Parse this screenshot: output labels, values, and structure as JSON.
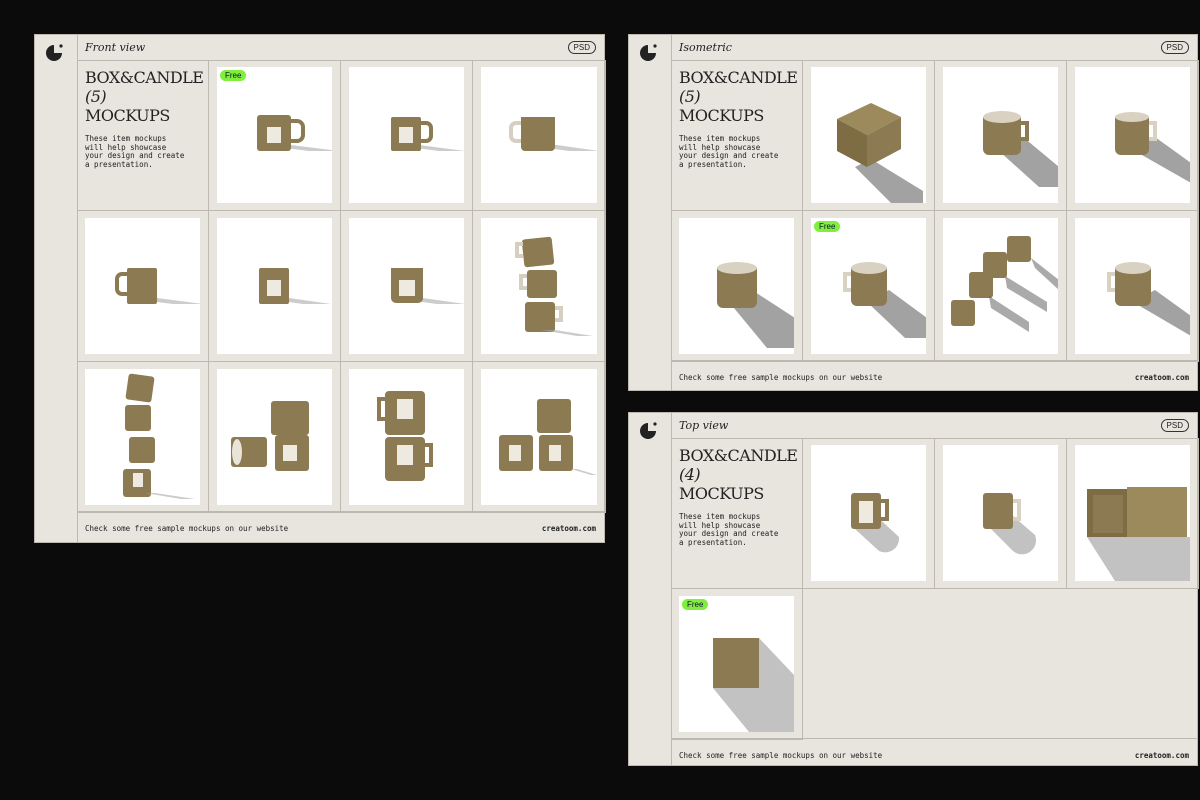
{
  "colors": {
    "background": "#0b0b0b",
    "panel": "#e8e5df",
    "line": "#bdb9b1",
    "mug": "#8b7a52",
    "free_badge": "#7ef03c"
  },
  "panels": [
    {
      "title": "Front view",
      "badge": "PSD",
      "intro": {
        "heading": "BOX&CANDLE",
        "count": "(5)",
        "subheading": "MOCKUPS",
        "text": "These item mockups will help showcase your design and create a presentation."
      },
      "footer": {
        "text": "Check some free sample mockups on our website",
        "link": "creatoom.com"
      },
      "free_label": "Free",
      "thumbnails": [
        {
          "icon": "mug-icon",
          "free": true
        },
        {
          "icon": "mug-icon"
        },
        {
          "icon": "mug-icon"
        },
        {
          "icon": "mug-icon"
        },
        {
          "icon": "mug-icon"
        },
        {
          "icon": "mug-icon"
        },
        {
          "icon": "mug-stack-icon"
        },
        {
          "icon": "mug-stack-icon"
        },
        {
          "icon": "mug-group-icon"
        },
        {
          "icon": "mug-stack-icon"
        },
        {
          "icon": "mug-group-icon"
        }
      ]
    },
    {
      "title": "Isometric",
      "badge": "PSD",
      "intro": {
        "heading": "BOX&CANDLE",
        "count": "(5)",
        "subheading": "MOCKUPS",
        "text": "These item mockups will help showcase your design and create a presentation."
      },
      "footer": {
        "text": "Check some free sample mockups on our website",
        "link": "creatoom.com"
      },
      "free_label": "Free",
      "thumbnails": [
        {
          "icon": "box-icon"
        },
        {
          "icon": "mug-icon"
        },
        {
          "icon": "mug-icon"
        },
        {
          "icon": "mug-icon"
        },
        {
          "icon": "mug-icon",
          "free": true
        },
        {
          "icon": "mug-group-icon"
        },
        {
          "icon": "mug-icon"
        }
      ]
    },
    {
      "title": "Top view",
      "badge": "PSD",
      "intro": {
        "heading": "BOX&CANDLE",
        "count": "(4)",
        "subheading": "MOCKUPS",
        "text": "These item mockups will help showcase your design and create a presentation."
      },
      "footer": {
        "text": "Check some free sample mockups on our website",
        "link": "creatoom.com"
      },
      "free_label": "Free",
      "thumbnails": [
        {
          "icon": "mug-icon"
        },
        {
          "icon": "mug-icon"
        },
        {
          "icon": "box-icon"
        },
        {
          "icon": "box-icon",
          "free": true
        }
      ]
    }
  ]
}
